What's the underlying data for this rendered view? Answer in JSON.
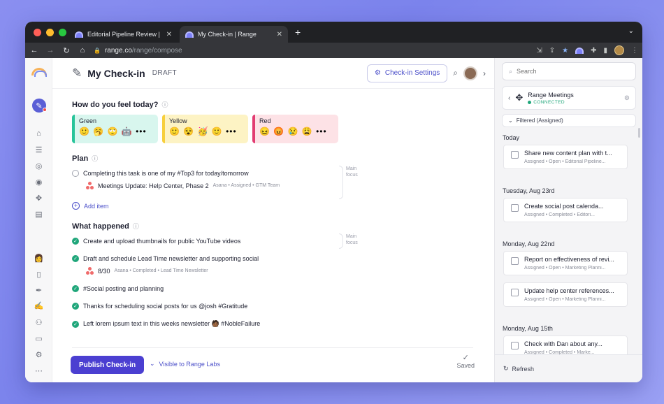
{
  "browser": {
    "tabs": [
      {
        "title": "Editorial Pipeline Review | Rang",
        "close": "✕"
      },
      {
        "title": "My Check-in | Range",
        "close": "✕"
      }
    ],
    "new_tab": "+",
    "url_host": "range.co",
    "url_path": "/range/compose"
  },
  "header": {
    "title": "My Check-in",
    "status": "DRAFT",
    "settings_label": "Check-in Settings"
  },
  "feel": {
    "title": "How do you feel today?",
    "moods": [
      {
        "label": "Green",
        "emojis": "🙂 🥱 🙄 🤖 •••",
        "bg": "#d8f6ee",
        "bar": "#27c49a"
      },
      {
        "label": "Yellow",
        "emojis": "🙂 😵 🥳 🙂 •••",
        "bg": "#fdf3c4",
        "bar": "#f7cf3c"
      },
      {
        "label": "Red",
        "emojis": "😖 😡 😢 😩 •••",
        "bg": "#fde2e6",
        "bar": "#e23c72"
      }
    ]
  },
  "plan": {
    "title": "Plan",
    "item_text": "Completing this task is one of my #Top3 for today/tomorrow",
    "linked_title": "Meetings Update: Help Center, Phase 2",
    "linked_meta": "Asana • Assigned • GTM Team",
    "focus_line1": "Main",
    "focus_line2": "focus",
    "add_label": "Add item"
  },
  "happened": {
    "title": "What happened",
    "focus_line1": "Main",
    "focus_line2": "focus",
    "items": [
      "Create and upload thumbnails for public YouTube videos",
      "Draft and schedule Lead Time newsletter and supporting social",
      "#Social posting and planning",
      "Thanks for scheduling social posts for us @josh #Gratitude",
      "Left lorem ipsum text in this weeks newsletter 🧑🏾 #NobleFailure"
    ],
    "linked_title": "8/30",
    "linked_meta": "Asana • Completed • Lead Time Newsletter"
  },
  "footer": {
    "publish_label": "Publish Check-in",
    "visibility_label": "Visible to Range Labs",
    "saved_label": "Saved"
  },
  "sidebar": {
    "search_placeholder": "Search",
    "integration_name": "Range Meetings",
    "integration_status": "CONNECTED",
    "filter_label": "Filtered (Assigned)",
    "groups": [
      {
        "day": "Today",
        "cards": [
          {
            "title": "Share new content plan with t...",
            "meta": "Assigned • Open • Editorial Pipeline..."
          }
        ]
      },
      {
        "day": "Tuesday, Aug 23rd",
        "cards": [
          {
            "title": "Create social post calenda...",
            "meta": "Assigned • Completed • Editori..."
          }
        ]
      },
      {
        "day": "Monday, Aug 22nd",
        "cards": [
          {
            "title": "Report on effectiveness of revi...",
            "meta": "Assigned • Open • Marketing Planni..."
          },
          {
            "title": "Update help center references...",
            "meta": "Assigned • Open • Marketing Planni..."
          }
        ]
      },
      {
        "day": "Monday, Aug 15th",
        "cards": [
          {
            "title": "Check with Dan about any...",
            "meta": "Assigned • Completed • Marke..."
          }
        ]
      }
    ],
    "refresh_label": "Refresh"
  },
  "colors": {
    "accent": "#4b3fd1",
    "success": "#1fa67a"
  }
}
